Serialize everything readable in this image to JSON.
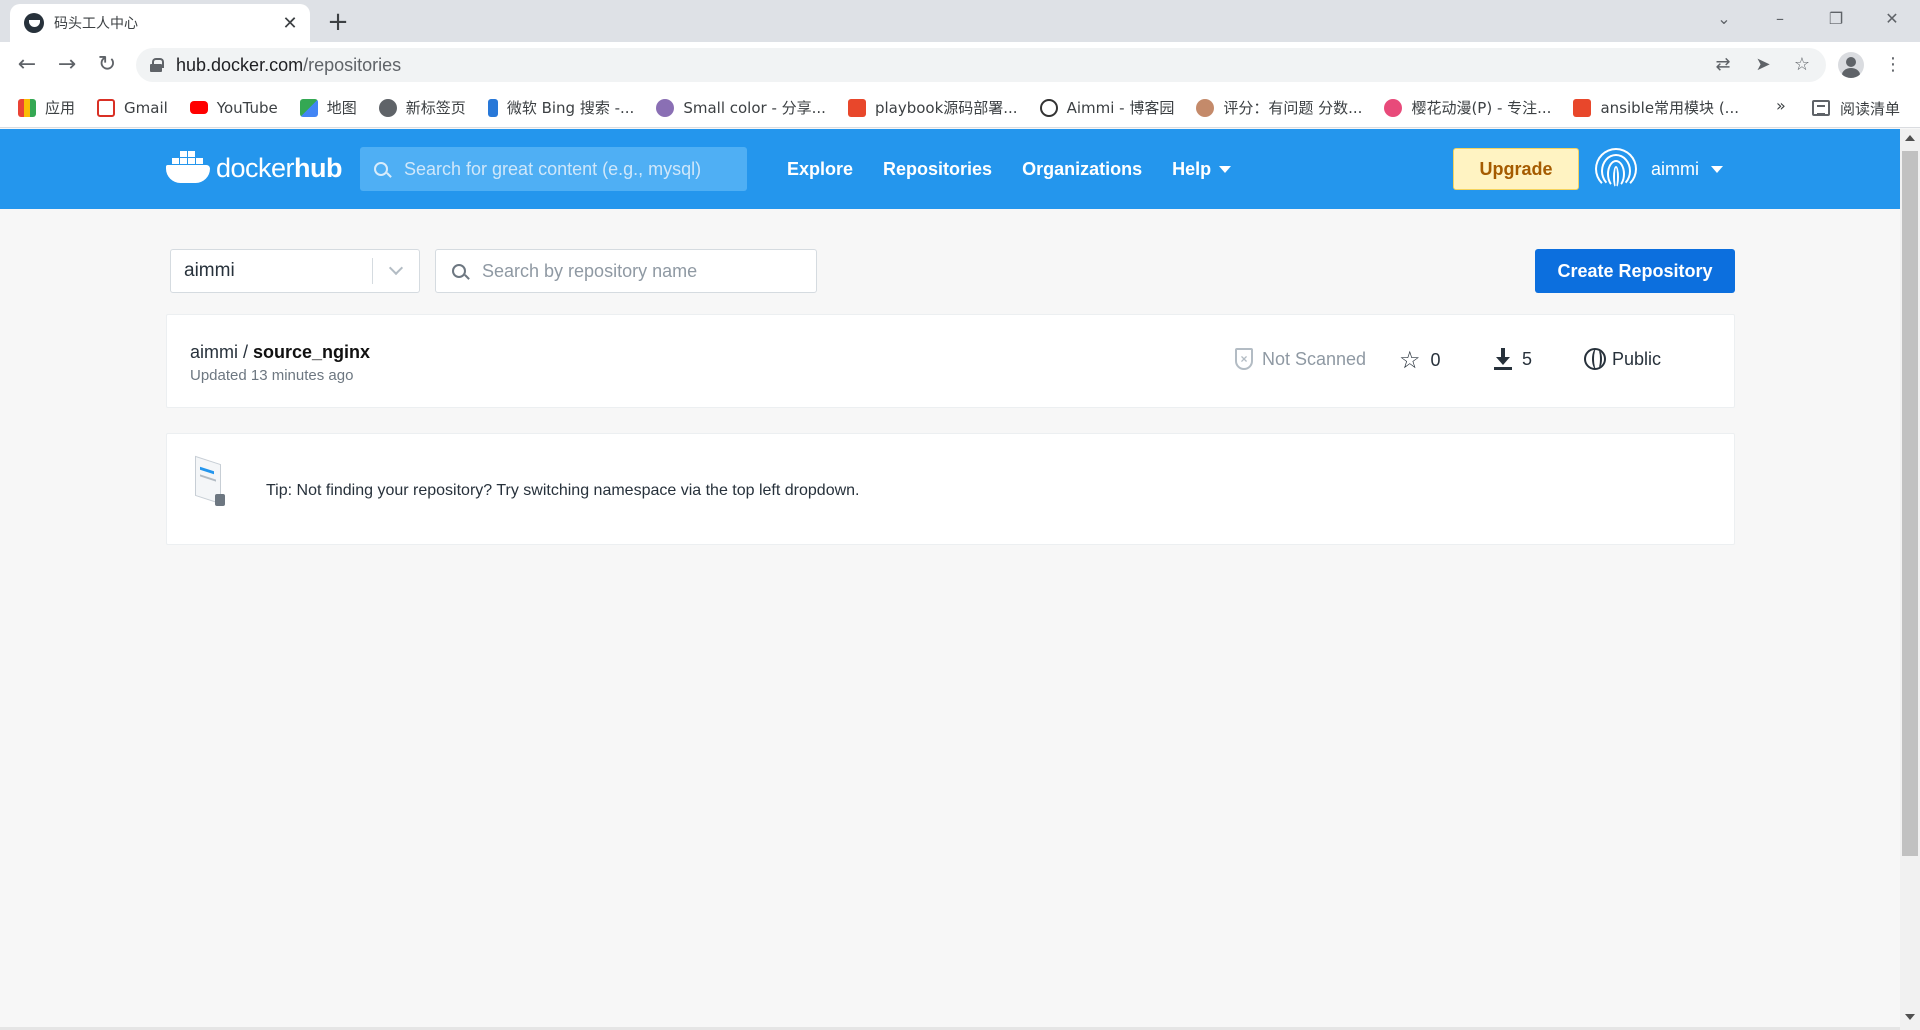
{
  "browser": {
    "tab_title": "码头工人中心",
    "tab_close": "✕",
    "new_tab": "+",
    "url_host": "hub.docker.com",
    "url_path": "/repositories",
    "more_bookmarks": "»",
    "reading_list": "阅读清单",
    "bookmarks": [
      {
        "label": "应用",
        "icon": "apps-grid-icon",
        "color": "#ea4335"
      },
      {
        "label": "Gmail",
        "icon": "gmail-icon",
        "color": "#d93025"
      },
      {
        "label": "YouTube",
        "icon": "youtube-icon",
        "color": "#ff0000"
      },
      {
        "label": "地图",
        "icon": "maps-icon",
        "color": "#34a853"
      },
      {
        "label": "新标签页",
        "icon": "globe-icon",
        "color": "#5f6368"
      },
      {
        "label": "微软 Bing 搜索 -...",
        "icon": "bing-icon",
        "color": "#2878d8"
      },
      {
        "label": "Small color - 分享...",
        "icon": "bear-icon",
        "color": "#8a6fb4"
      },
      {
        "label": "playbook源码部署...",
        "icon": "csdn-icon",
        "color": "#e8472b"
      },
      {
        "label": "Aimmi - 博客园",
        "icon": "cnblogs-icon",
        "color": "#333333"
      },
      {
        "label": "评分：有问题 分数...",
        "icon": "avatar-girl-icon",
        "color": "#c48a6a"
      },
      {
        "label": "樱花动漫(P) - 专注...",
        "icon": "sakura-icon",
        "color": "#e84a7a"
      },
      {
        "label": "ansible常用模块 (...",
        "icon": "csdn-icon",
        "color": "#e8472b"
      }
    ]
  },
  "header": {
    "logo_text_a": "docker",
    "logo_text_b": "hub",
    "search_placeholder": "Search for great content (e.g., mysql)",
    "nav": [
      "Explore",
      "Repositories",
      "Organizations",
      "Help"
    ],
    "upgrade_label": "Upgrade",
    "username": "aimmi"
  },
  "toolbar": {
    "namespace": "aimmi",
    "repo_search_placeholder": "Search by repository name",
    "create_label": "Create Repository"
  },
  "repositories": [
    {
      "namespace": "aimmi / ",
      "name": "source_nginx",
      "updated": "Updated 13 minutes ago",
      "scan_status": "Not Scanned",
      "stars": "0",
      "pulls": "5",
      "visibility": "Public"
    }
  ],
  "tip": {
    "text": "Tip: Not finding your repository? Try switching namespace via the top left dropdown."
  },
  "colors": {
    "brand": "#2496ed",
    "primary_button": "#0c6fde",
    "upgrade_bg": "#fff3c2"
  }
}
